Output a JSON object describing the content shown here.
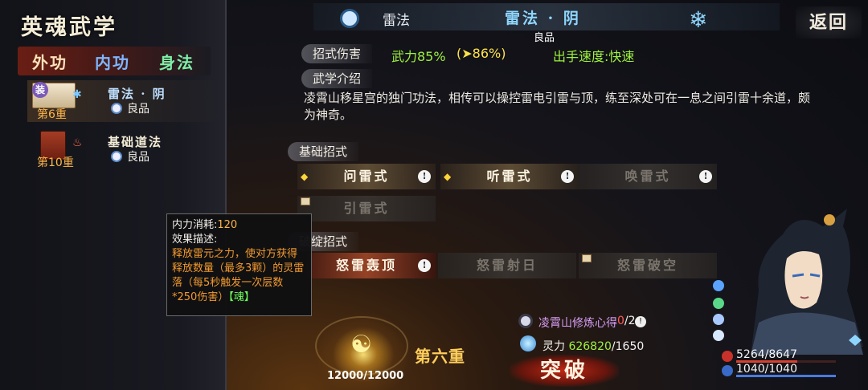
{
  "panel": {
    "title": "英魂武学",
    "tabs": [
      {
        "label": "外功",
        "active": true
      },
      {
        "label": "内功",
        "active": false
      },
      {
        "label": "身法",
        "active": false
      }
    ],
    "skills": [
      {
        "name": "雷法 · 阴",
        "grade": "良品",
        "level": "第6重",
        "equipped_tag": "装",
        "selected": true
      },
      {
        "name": "基础道法",
        "grade": "良品",
        "level": "第10重",
        "selected": false
      }
    ]
  },
  "header": {
    "style": "雷法",
    "title": "雷法 · 阴",
    "grade": "良品",
    "back_label": "返回"
  },
  "stats": {
    "damage_label": "招式伤害",
    "damage_power": "武力85%",
    "damage_bonus": "(➤86%)",
    "speed": "出手速度:快速",
    "intro_label": "武学介绍",
    "intro_text": "凌霄山移星宫的独门功法，相传可以操控雷电引雷与顶，练至深处可在一息之间引雷十余道，颇为神奇。"
  },
  "moves": {
    "basic_label": "基础招式",
    "break_label": "破绽招式",
    "basic": [
      {
        "name": "问雷式",
        "state": "active"
      },
      {
        "name": "听雷式",
        "state": "active"
      },
      {
        "name": "唤雷式",
        "state": "locked"
      },
      {
        "name": "引雷式",
        "state": "locked"
      }
    ],
    "break": [
      {
        "name": "怒雷轰顶",
        "state": "active"
      },
      {
        "name": "怒雷射日",
        "state": "locked"
      },
      {
        "name": "怒雷破空",
        "state": "locked"
      }
    ]
  },
  "tooltip": {
    "cost_label": "内力消耗:",
    "cost_value": "120",
    "effect_label": "效果描述:",
    "effect_text": "释放雷元之力，使对方获得释放数量（最多3颗）的灵雷落（每5秒触发一次层数*250伤害）",
    "soul_tag": "【魂】"
  },
  "cultivation": {
    "orb_value": "12000/12000",
    "stage": "第六重",
    "heart_text": "凌霄山修炼心得",
    "heart_now": "0",
    "heart_total": "/2",
    "spirit_label": "灵力",
    "spirit_have": "626820",
    "spirit_need": "/1650",
    "breakthrough_label": "突破"
  },
  "character": {
    "hp_text": "5264/8647",
    "hp_fraction": 0.609,
    "mp_text": "1040/1040",
    "mp_fraction": 1.0
  },
  "colors": {
    "green": "#9ef23e",
    "gold": "#ffe34a",
    "orange": "#f29a2e",
    "ice": "#8fd6ff"
  },
  "icons": {
    "header_left": "thunder-seal-icon",
    "header_right": "snowflake-icon",
    "orb": "meditation-icon",
    "heart": "scroll-icon",
    "spirit": "swirl-icon"
  }
}
